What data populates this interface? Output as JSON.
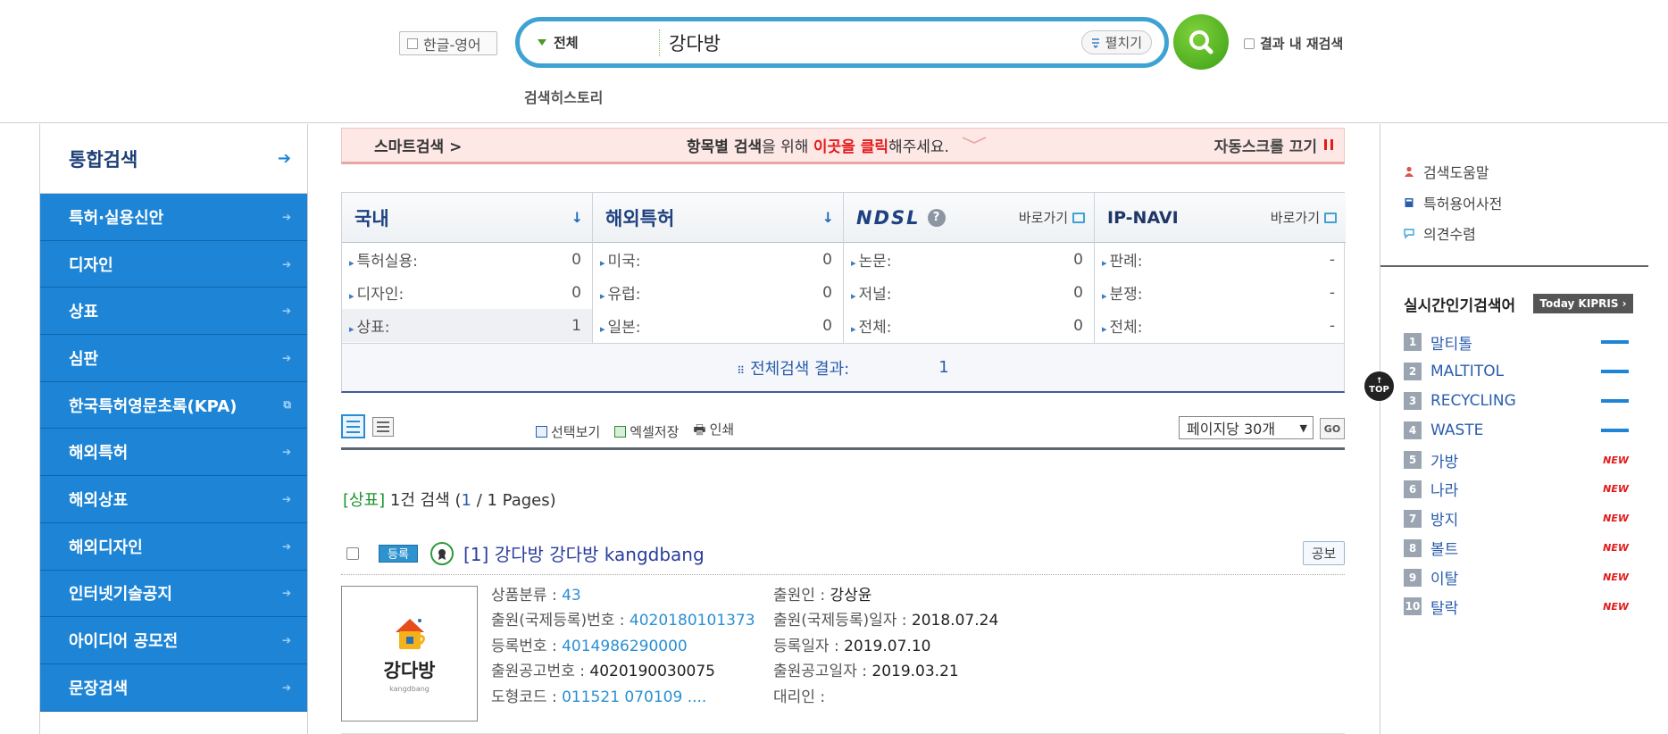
{
  "header": {
    "lang_toggle": "한글-영어",
    "scope": "전체",
    "query": "강다방",
    "expand": "펼치기",
    "research": "결과 내 재검색",
    "history": "검색히스토리"
  },
  "sidebar": {
    "main": "통합검색",
    "items": [
      {
        "label": "특허·실용신안"
      },
      {
        "label": "디자인"
      },
      {
        "label": "상표"
      },
      {
        "label": "심판"
      },
      {
        "label": "한국특허영문초록(KPA)"
      },
      {
        "label": "해외특허"
      },
      {
        "label": "해외상표"
      },
      {
        "label": "해외디자인"
      },
      {
        "label": "인터넷기술공지"
      },
      {
        "label": "아이디어 공모전"
      },
      {
        "label": "문장검색"
      }
    ]
  },
  "smart_bar": {
    "label": "스마트검색 >",
    "msg_bold": "항목별 검색",
    "msg_mid": "을 위해 ",
    "msg_red": "이곳을 클릭",
    "msg_end": "해주세요.",
    "auto_scroll": "자동스크롤 끄기"
  },
  "counts": {
    "domestic": {
      "title": "국내",
      "rows": [
        {
          "label": "특허실용:",
          "value": "0"
        },
        {
          "label": "디자인:",
          "value": "0"
        },
        {
          "label": "상표:",
          "value": "1"
        }
      ]
    },
    "overseas": {
      "title": "해외특허",
      "rows": [
        {
          "label": "미국:",
          "value": "0"
        },
        {
          "label": "유럽:",
          "value": "0"
        },
        {
          "label": "일본:",
          "value": "0"
        }
      ]
    },
    "ndsl": {
      "title": "NDSL",
      "go": "바로가기",
      "rows": [
        {
          "label": "논문:",
          "value": "0"
        },
        {
          "label": "저널:",
          "value": "0"
        },
        {
          "label": "전체:",
          "value": "0"
        }
      ]
    },
    "ipnavi": {
      "title": "IP-NAVI",
      "go": "바로가기",
      "rows": [
        {
          "label": "판례:",
          "value": "-"
        },
        {
          "label": "분쟁:",
          "value": "-"
        },
        {
          "label": "전체:",
          "value": "-"
        }
      ]
    },
    "total_label": "전체검색 결과:",
    "total_value": "1"
  },
  "toolbar": {
    "select_view": "선택보기",
    "excel": "엑셀저장",
    "print": "인쇄",
    "per_page": "페이지당 30개",
    "go": "GO"
  },
  "results": {
    "category": "[상표]",
    "count_text": "1건 검색 (",
    "page_current": "1",
    "page_rest": " / 1 Pages)",
    "item": {
      "badge": "등록",
      "title": "[1] 강다방 강다방 kangdbang",
      "gazette": "공보",
      "thumb_text": "강다방",
      "thumb_sub": "kangdbang",
      "class_label": "상품분류 : ",
      "class_value": "43",
      "app_no_label": "출원(국제등록)번호 : ",
      "app_no_value": "4020180101373",
      "reg_no_label": "등록번호 : ",
      "reg_no_value": "4014986290000",
      "pub_no_label": "출원공고번호 : ",
      "pub_no_value": "4020190030075",
      "design_code_label": "도형코드 : ",
      "design_code_value": "011521 070109 ....",
      "applicant_label": "출원인 : ",
      "applicant_value": "강상윤",
      "app_date_label": "출원(국제등록)일자 : ",
      "app_date_value": "2018.07.24",
      "reg_date_label": "등록일자 : ",
      "reg_date_value": "2019.07.10",
      "pub_date_label": "출원공고일자 : ",
      "pub_date_value": "2019.03.21",
      "agent_label": "대리인 : "
    }
  },
  "right_panel": {
    "help": [
      "검색도움말",
      "특허용어사전",
      "의견수렴"
    ],
    "realtime_title": "실시간인기검색어",
    "today_badge": "Today KIPRIS ›",
    "popular": [
      {
        "rank": "1",
        "term": "말티톨",
        "trend": "same"
      },
      {
        "rank": "2",
        "term": "MALTITOL",
        "trend": "same"
      },
      {
        "rank": "3",
        "term": "RECYCLING",
        "trend": "same"
      },
      {
        "rank": "4",
        "term": "WASTE",
        "trend": "same"
      },
      {
        "rank": "5",
        "term": "가방",
        "trend": "NEW"
      },
      {
        "rank": "6",
        "term": "나라",
        "trend": "NEW"
      },
      {
        "rank": "7",
        "term": "방지",
        "trend": "NEW"
      },
      {
        "rank": "8",
        "term": "볼트",
        "trend": "NEW"
      },
      {
        "rank": "9",
        "term": "이탈",
        "trend": "NEW"
      },
      {
        "rank": "10",
        "term": "탈락",
        "trend": "NEW"
      }
    ],
    "top": "TOP"
  },
  "colors": {
    "sidebar_blue": "#1e85d6",
    "search_border": "#3ea3d2",
    "search_button": "#3b9f14",
    "link_blue": "#2a8fd4",
    "alert_red": "#e21a1a"
  }
}
